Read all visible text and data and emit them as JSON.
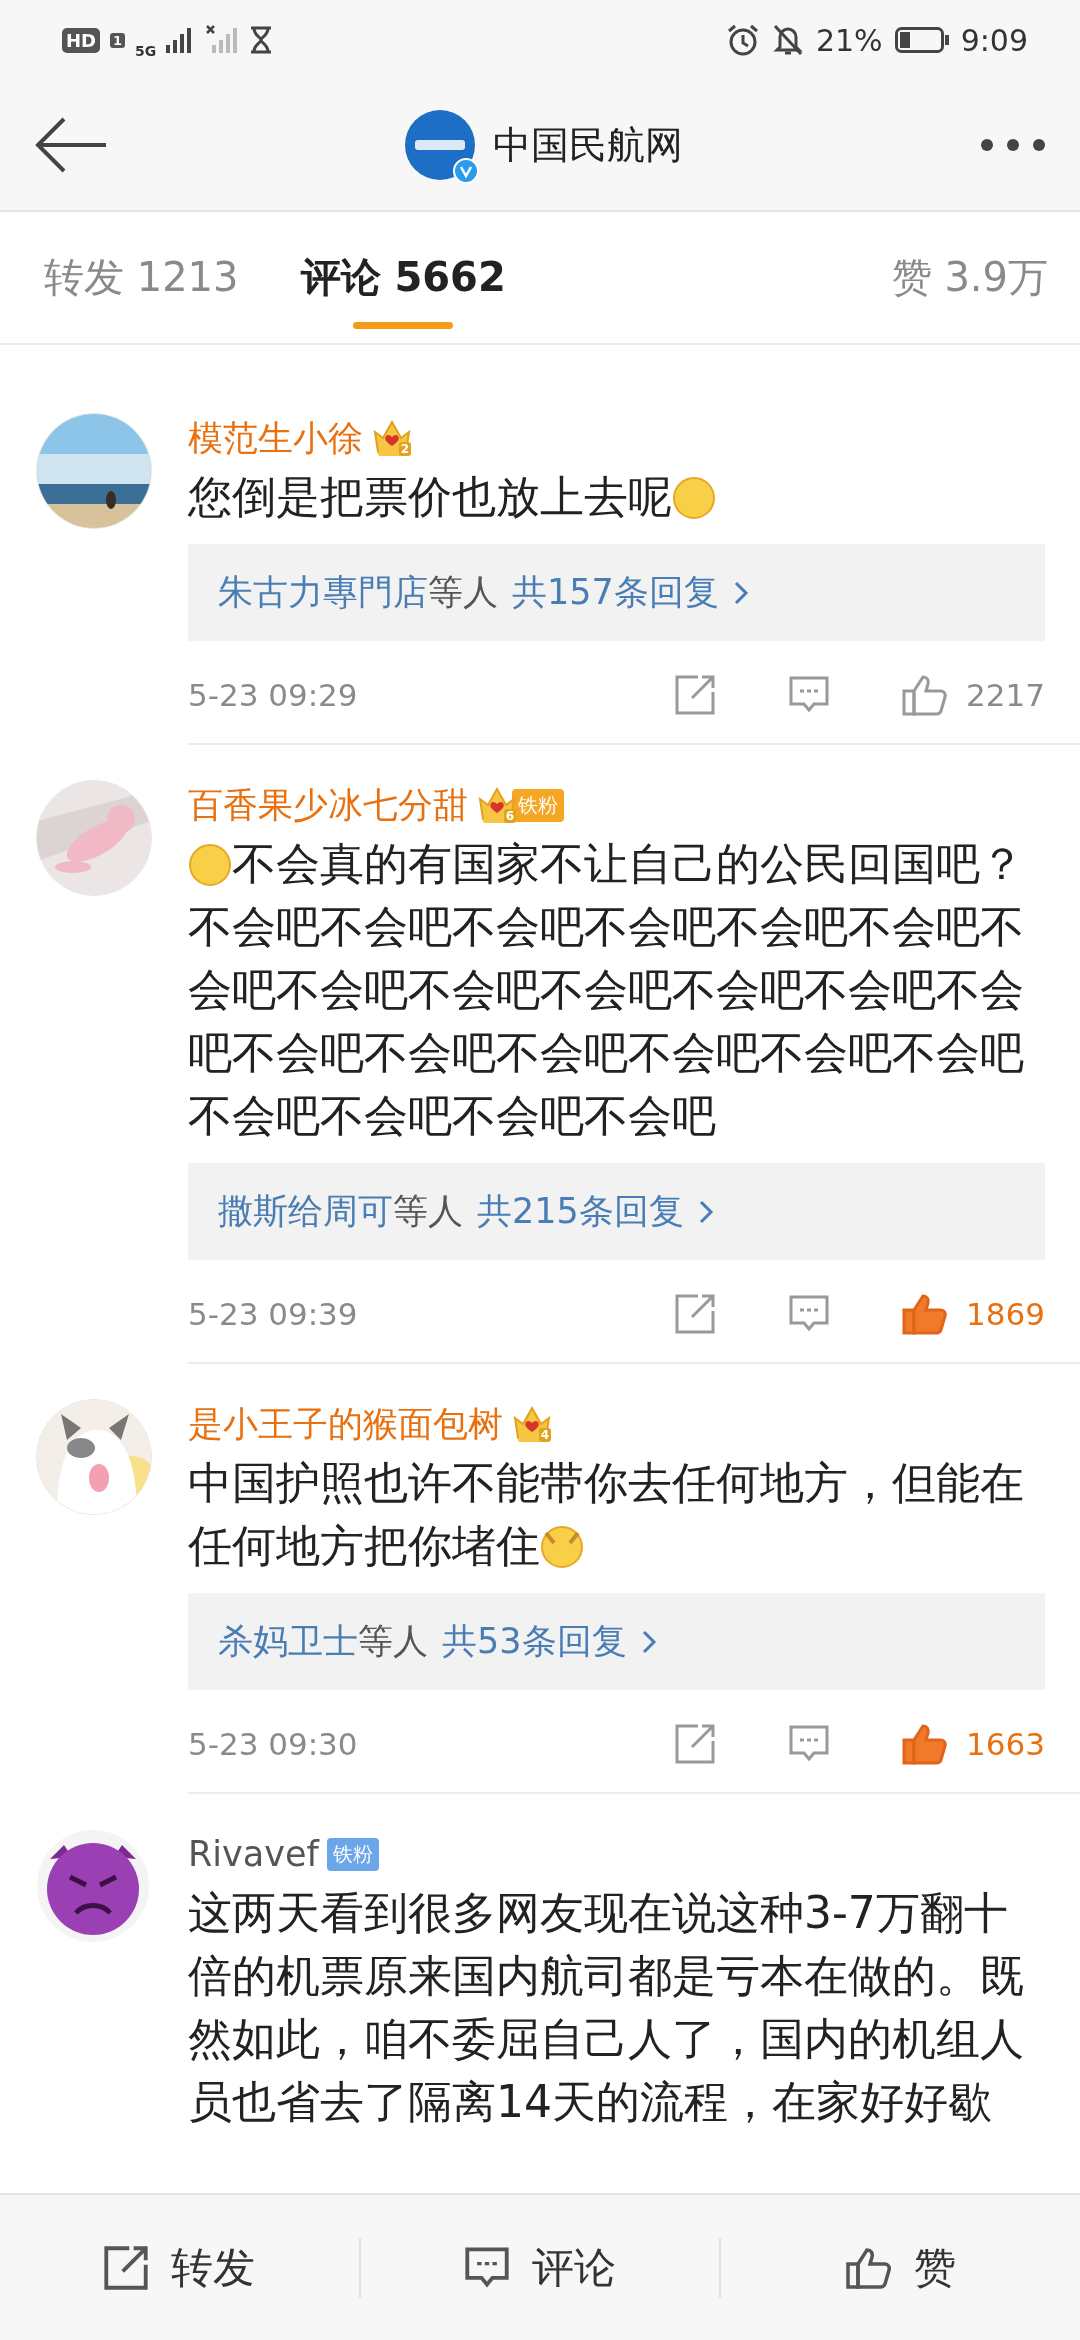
{
  "status_bar": {
    "hd": "HD",
    "sim": "1",
    "network": "5G",
    "battery_percent": "21%",
    "time": "9:09"
  },
  "header": {
    "title": "中国民航网",
    "verified": true
  },
  "tabs": [
    {
      "label": "转发 1213",
      "selected": false
    },
    {
      "label": "评论 5662",
      "selected": true
    },
    {
      "label": "赞 3.9万",
      "selected": false
    }
  ],
  "comments": [
    {
      "name": "模范生小徐",
      "crown_level": "2",
      "body": "您倒是把票价也放上去呢",
      "emoji_before": false,
      "emoji_after": true,
      "replies": {
        "who": "朱古力專門店",
        "suffix": "等人",
        "count": "共157条回复"
      },
      "time": "5-23 09:29",
      "likes": "2217",
      "liked": false
    },
    {
      "name": "百香果少冰七分甜",
      "crown_level": "6",
      "fan_badge": {
        "text": "铁粉",
        "color": "#f5a623"
      },
      "body": "不会真的有国家不让自己的公民回国吧？不会吧不会吧不会吧不会吧不会吧不会吧不会吧不会吧不会吧不会吧不会吧不会吧不会吧不会吧不会吧不会吧不会吧不会吧不会吧不会吧不会吧不会吧不会吧",
      "emoji_before": true,
      "emoji_after": false,
      "replies": {
        "who": "撒斯给周可",
        "suffix": "等人",
        "count": "共215条回复"
      },
      "time": "5-23 09:39",
      "likes": "1869",
      "liked": true
    },
    {
      "name": "是小王子的猴面包树",
      "crown_level": "4",
      "body": "中国护照也许不能带你去任何地方，但能在任何地方把你堵住",
      "emoji_before": false,
      "emoji_after": true,
      "replies": {
        "who": "杀妈卫士",
        "suffix": "等人",
        "count": "共53条回复"
      },
      "time": "5-23 09:30",
      "likes": "1663",
      "liked": true
    },
    {
      "avatar": {
        "kind": "emoji"
      },
      "name": "Rivavef",
      "fan_badge": {
        "text": "铁粉",
        "color": "#6aa6e8"
      },
      "body": "这两天看到很多网友现在说这种3-7万翻十倍的机票原来国内航司都是亏本在做的。既然如此，咱不委屈自己人了，国内的机组人员也省去了隔离14天的流程，在家好好歇",
      "emoji_before": false,
      "emoji_after": false
    }
  ],
  "bottom_bar": [
    {
      "kind": "share",
      "label": "转发"
    },
    {
      "kind": "comment",
      "label": "评论"
    },
    {
      "kind": "like",
      "label": "赞"
    }
  ]
}
